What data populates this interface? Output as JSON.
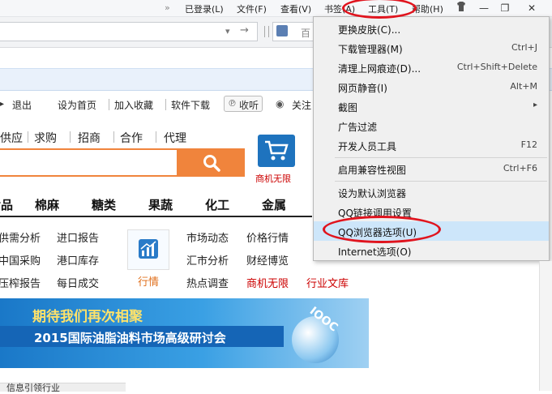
{
  "menubar": {
    "chevron": "»",
    "items": [
      "已登录(L)",
      "文件(F)",
      "查看(V)",
      "书签(A)",
      "工具(T)",
      "帮助(H)"
    ],
    "window_controls": [
      "—",
      "❐",
      "✕"
    ]
  },
  "addressbar": {
    "search_hint": "百"
  },
  "page": {
    "top_links": [
      "退出",
      "设为首页",
      "加入收藏",
      "软件下载",
      "收听",
      "关注"
    ],
    "categories": [
      "供应",
      "求购",
      "招商",
      "合作",
      "代理"
    ],
    "cart_label": "商机无限",
    "main_nav": [
      "食品",
      "棉麻",
      "糖类",
      "果蔬",
      "化工",
      "金属"
    ],
    "links_col1": [
      "供需分析",
      "中国采购",
      "压榨报告"
    ],
    "links_col2": [
      "进口报告",
      "港口库存",
      "每日成交"
    ],
    "hangqing_label": "行情",
    "links_col3": [
      "市场动态",
      "汇市分析",
      "热点调查"
    ],
    "links_col4": [
      "价格行情",
      "财经博览",
      "商机无限"
    ],
    "links_col5": [
      "行业文库"
    ],
    "banner": {
      "line1": "期待我们再次相聚",
      "line2": "2015国际油脂油料市场高级研讨会",
      "badge": "IOOC"
    },
    "bottom_text": "信息引领行业"
  },
  "dropdown": {
    "items": [
      {
        "label": "更换皮肤(C)...",
        "shortcut": ""
      },
      {
        "label": "下载管理器(M)",
        "shortcut": "Ctrl+J"
      },
      {
        "label": "清理上网痕迹(D)...",
        "shortcut": "Ctrl+Shift+Delete"
      },
      {
        "label": "网页静音(I)",
        "shortcut": "Alt+M"
      },
      {
        "label": "截图",
        "shortcut": "▸"
      },
      {
        "label": "广告过滤",
        "shortcut": ""
      },
      {
        "label": "开发人员工具",
        "shortcut": "F12"
      },
      {
        "label": "启用兼容性视图",
        "shortcut": "Ctrl+F6"
      },
      {
        "label": "设为默认浏览器",
        "shortcut": ""
      },
      {
        "label": "QQ链接调用设置",
        "shortcut": ""
      },
      {
        "label": "QQ浏览器选项(U)",
        "shortcut": ""
      },
      {
        "label": "Internet选项(O)",
        "shortcut": ""
      }
    ]
  },
  "colors": {
    "accent_orange": "#f0843c",
    "annotation_red": "#e0141e",
    "highlight": "#cde6fa",
    "banner_blue": "#2a8fd8"
  }
}
